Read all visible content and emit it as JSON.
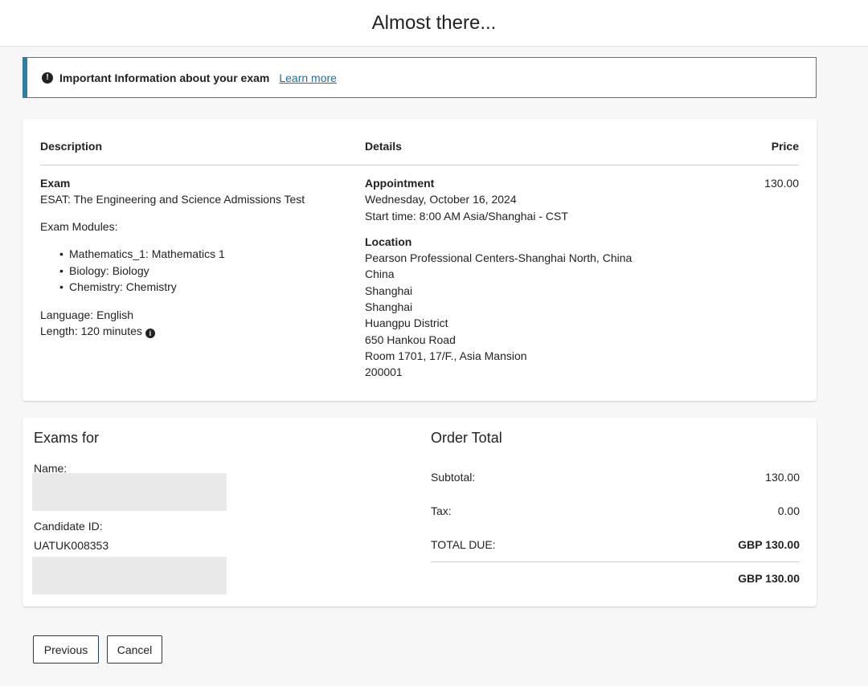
{
  "header": {
    "title": "Almost there..."
  },
  "alert": {
    "icon": "info-icon",
    "title": "Important Information about your exam",
    "link_text": "Learn more"
  },
  "details_table": {
    "headers": {
      "description": "Description",
      "details": "Details",
      "price": "Price"
    },
    "description": {
      "exam_label": "Exam",
      "exam_name": "ESAT: The Engineering and Science Admissions Test",
      "modules_label": "Exam Modules:",
      "modules": [
        "Mathematics_1: Mathematics 1",
        "Biology: Biology",
        "Chemistry: Chemistry"
      ],
      "language": "Language: English",
      "length": "Length: 120 minutes"
    },
    "details": {
      "appointment_label": "Appointment",
      "date": "Wednesday, October 16, 2024",
      "start_time": "Start time: 8:00 AM Asia/Shanghai - CST",
      "location_label": "Location",
      "location_lines": [
        "Pearson Professional Centers-Shanghai North, China",
        "China",
        "Shanghai",
        "Shanghai",
        "Huangpu District",
        "650 Hankou Road",
        "Room 1701, 17/F., Asia Mansion",
        "200001"
      ]
    },
    "price": "130.00"
  },
  "exams_for": {
    "title": "Exams for",
    "name_label": "Name:",
    "candidate_id_label": "Candidate ID:",
    "candidate_id": "UATUK008353"
  },
  "order_total": {
    "title": "Order Total",
    "subtotal_label": "Subtotal:",
    "subtotal": "130.00",
    "tax_label": "Tax:",
    "tax": "0.00",
    "total_due_label": "TOTAL DUE:",
    "total_due": "GBP 130.00",
    "grand_total": "GBP 130.00"
  },
  "buttons": {
    "previous": "Previous",
    "cancel": "Cancel"
  }
}
